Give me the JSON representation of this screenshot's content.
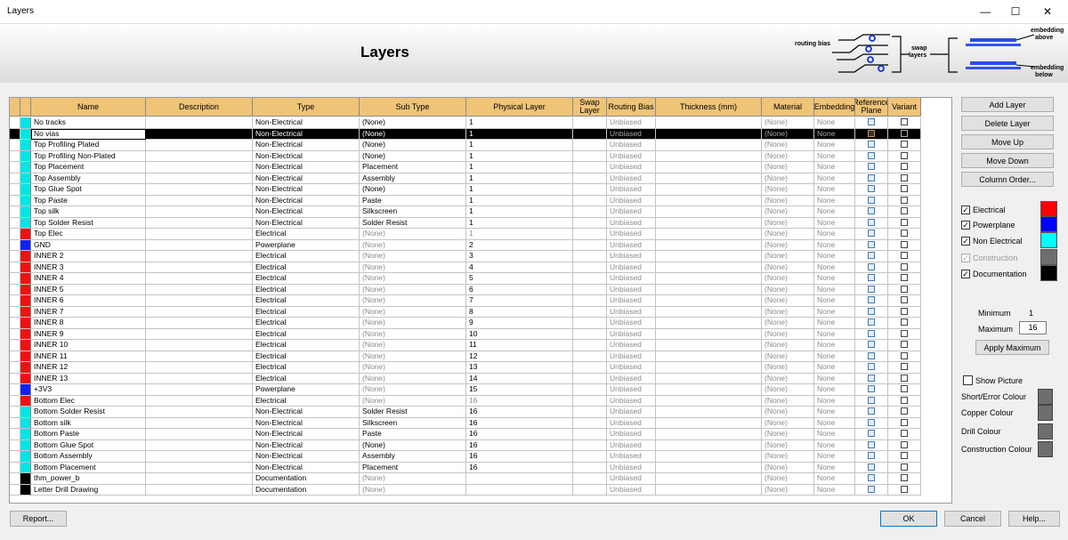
{
  "window": {
    "title": "Layers",
    "controls": [
      "—",
      "☐",
      "✕"
    ]
  },
  "header": {
    "title": "Layers",
    "diagram": {
      "routing_bias": "routing bias",
      "swap1": "swap",
      "swap2": "layers",
      "emb_above1": "embedding",
      "emb_above2": "above",
      "emb_below1": "embedding",
      "emb_below2": "below"
    }
  },
  "columns": [
    "Name",
    "Description",
    "Type",
    "Sub Type",
    "Physical Layer",
    "Swap Layer",
    "Routing Bias",
    "Thickness (mm)",
    "Material",
    "Embedding",
    "Reference Plane",
    "Variant"
  ],
  "rows": [
    {
      "color": "#00e5e5",
      "name": "No tracks",
      "desc": "",
      "type": "Non-Electrical",
      "subtype": "(None)",
      "sub_gray": false,
      "phys": "1",
      "phys_gray": false,
      "bias": "Unbiased",
      "mat": "(None)",
      "emb": "None",
      "sel": false
    },
    {
      "color": "#00e5e5",
      "name": "No vias",
      "desc": "",
      "type": "Non-Electrical",
      "subtype": "(None)",
      "sub_gray": false,
      "phys": "1",
      "phys_gray": false,
      "bias": "Unbiased",
      "mat": "(None)",
      "emb": "None",
      "sel": true
    },
    {
      "color": "#00e5e5",
      "name": "Top Profiling Plated",
      "desc": "",
      "type": "Non-Electrical",
      "subtype": "(None)",
      "sub_gray": false,
      "phys": "1",
      "phys_gray": false,
      "bias": "Unbiased",
      "mat": "(None)",
      "emb": "None",
      "sel": false
    },
    {
      "color": "#00e5e5",
      "name": "Top Profiling Non-Plated",
      "desc": "",
      "type": "Non-Electrical",
      "subtype": "(None)",
      "sub_gray": false,
      "phys": "1",
      "phys_gray": false,
      "bias": "Unbiased",
      "mat": "(None)",
      "emb": "None",
      "sel": false
    },
    {
      "color": "#00e5e5",
      "name": "Top Placement",
      "desc": "",
      "type": "Non-Electrical",
      "subtype": "Placement",
      "sub_gray": false,
      "phys": "1",
      "phys_gray": false,
      "bias": "Unbiased",
      "mat": "(None)",
      "emb": "None",
      "sel": false
    },
    {
      "color": "#00e5e5",
      "name": "Top Assembly",
      "desc": "",
      "type": "Non-Electrical",
      "subtype": "Assembly",
      "sub_gray": false,
      "phys": "1",
      "phys_gray": false,
      "bias": "Unbiased",
      "mat": "(None)",
      "emb": "None",
      "sel": false
    },
    {
      "color": "#00e5e5",
      "name": "Top Glue Spot",
      "desc": "",
      "type": "Non-Electrical",
      "subtype": "(None)",
      "sub_gray": false,
      "phys": "1",
      "phys_gray": false,
      "bias": "Unbiased",
      "mat": "(None)",
      "emb": "None",
      "sel": false
    },
    {
      "color": "#00e5e5",
      "name": "Top Paste",
      "desc": "",
      "type": "Non-Electrical",
      "subtype": "Paste",
      "sub_gray": false,
      "phys": "1",
      "phys_gray": false,
      "bias": "Unbiased",
      "mat": "(None)",
      "emb": "None",
      "sel": false
    },
    {
      "color": "#00e5e5",
      "name": "Top silk",
      "desc": "",
      "type": "Non-Electrical",
      "subtype": "Silkscreen",
      "sub_gray": false,
      "phys": "1",
      "phys_gray": false,
      "bias": "Unbiased",
      "mat": "(None)",
      "emb": "None",
      "sel": false
    },
    {
      "color": "#00e5e5",
      "name": "Top Solder Resist",
      "desc": "",
      "type": "Non-Electrical",
      "subtype": "Solder Resist",
      "sub_gray": false,
      "phys": "1",
      "phys_gray": false,
      "bias": "Unbiased",
      "mat": "(None)",
      "emb": "None",
      "sel": false
    },
    {
      "color": "#ee1111",
      "name": "Top Elec",
      "desc": "",
      "type": "Electrical",
      "subtype": "(None)",
      "sub_gray": true,
      "phys": "1",
      "phys_gray": true,
      "bias": "Unbiased",
      "mat": "(None)",
      "emb": "None",
      "sel": false
    },
    {
      "color": "#1122ee",
      "name": "GND",
      "desc": "",
      "type": "Powerplane",
      "subtype": "(None)",
      "sub_gray": true,
      "phys": "2",
      "phys_gray": false,
      "bias": "Unbiased",
      "mat": "(None)",
      "emb": "None",
      "sel": false
    },
    {
      "color": "#ee1111",
      "name": "INNER 2",
      "desc": "",
      "type": "Electrical",
      "subtype": "(None)",
      "sub_gray": true,
      "phys": "3",
      "phys_gray": false,
      "bias": "Unbiased",
      "mat": "(None)",
      "emb": "None",
      "sel": false
    },
    {
      "color": "#ee1111",
      "name": "INNER 3",
      "desc": "",
      "type": "Electrical",
      "subtype": "(None)",
      "sub_gray": true,
      "phys": "4",
      "phys_gray": false,
      "bias": "Unbiased",
      "mat": "(None)",
      "emb": "None",
      "sel": false
    },
    {
      "color": "#ee1111",
      "name": "INNER 4",
      "desc": "",
      "type": "Electrical",
      "subtype": "(None)",
      "sub_gray": true,
      "phys": "5",
      "phys_gray": false,
      "bias": "Unbiased",
      "mat": "(None)",
      "emb": "None",
      "sel": false
    },
    {
      "color": "#ee1111",
      "name": "INNER 5",
      "desc": "",
      "type": "Electrical",
      "subtype": "(None)",
      "sub_gray": true,
      "phys": "6",
      "phys_gray": false,
      "bias": "Unbiased",
      "mat": "(None)",
      "emb": "None",
      "sel": false
    },
    {
      "color": "#ee1111",
      "name": "INNER 6",
      "desc": "",
      "type": "Electrical",
      "subtype": "(None)",
      "sub_gray": true,
      "phys": "7",
      "phys_gray": false,
      "bias": "Unbiased",
      "mat": "(None)",
      "emb": "None",
      "sel": false
    },
    {
      "color": "#ee1111",
      "name": "INNER 7",
      "desc": "",
      "type": "Electrical",
      "subtype": "(None)",
      "sub_gray": true,
      "phys": "8",
      "phys_gray": false,
      "bias": "Unbiased",
      "mat": "(None)",
      "emb": "None",
      "sel": false
    },
    {
      "color": "#ee1111",
      "name": "INNER 8",
      "desc": "",
      "type": "Electrical",
      "subtype": "(None)",
      "sub_gray": true,
      "phys": "9",
      "phys_gray": false,
      "bias": "Unbiased",
      "mat": "(None)",
      "emb": "None",
      "sel": false
    },
    {
      "color": "#ee1111",
      "name": "INNER 9",
      "desc": "",
      "type": "Electrical",
      "subtype": "(None)",
      "sub_gray": true,
      "phys": "10",
      "phys_gray": false,
      "bias": "Unbiased",
      "mat": "(None)",
      "emb": "None",
      "sel": false
    },
    {
      "color": "#ee1111",
      "name": "INNER 10",
      "desc": "",
      "type": "Electrical",
      "subtype": "(None)",
      "sub_gray": true,
      "phys": "11",
      "phys_gray": false,
      "bias": "Unbiased",
      "mat": "(None)",
      "emb": "None",
      "sel": false
    },
    {
      "color": "#ee1111",
      "name": "INNER 11",
      "desc": "",
      "type": "Electrical",
      "subtype": "(None)",
      "sub_gray": true,
      "phys": "12",
      "phys_gray": false,
      "bias": "Unbiased",
      "mat": "(None)",
      "emb": "None",
      "sel": false
    },
    {
      "color": "#ee1111",
      "name": "INNER 12",
      "desc": "",
      "type": "Electrical",
      "subtype": "(None)",
      "sub_gray": true,
      "phys": "13",
      "phys_gray": false,
      "bias": "Unbiased",
      "mat": "(None)",
      "emb": "None",
      "sel": false
    },
    {
      "color": "#ee1111",
      "name": "INNER 13",
      "desc": "",
      "type": "Electrical",
      "subtype": "(None)",
      "sub_gray": true,
      "phys": "14",
      "phys_gray": false,
      "bias": "Unbiased",
      "mat": "(None)",
      "emb": "None",
      "sel": false
    },
    {
      "color": "#1122ee",
      "name": "+3V3",
      "desc": "",
      "type": "Powerplane",
      "subtype": "(None)",
      "sub_gray": true,
      "phys": "15",
      "phys_gray": false,
      "bias": "Unbiased",
      "mat": "(None)",
      "emb": "None",
      "sel": false
    },
    {
      "color": "#ee1111",
      "name": "Bottom Elec",
      "desc": "",
      "type": "Electrical",
      "subtype": "(None)",
      "sub_gray": true,
      "phys": "16",
      "phys_gray": true,
      "bias": "Unbiased",
      "mat": "(None)",
      "emb": "None",
      "sel": false
    },
    {
      "color": "#00e5e5",
      "name": "Bottom Solder Resist",
      "desc": "",
      "type": "Non-Electrical",
      "subtype": "Solder Resist",
      "sub_gray": false,
      "phys": "16",
      "phys_gray": false,
      "bias": "Unbiased",
      "mat": "(None)",
      "emb": "None",
      "sel": false
    },
    {
      "color": "#00e5e5",
      "name": "Bottom silk",
      "desc": "",
      "type": "Non-Electrical",
      "subtype": "Silkscreen",
      "sub_gray": false,
      "phys": "16",
      "phys_gray": false,
      "bias": "Unbiased",
      "mat": "(None)",
      "emb": "None",
      "sel": false
    },
    {
      "color": "#00e5e5",
      "name": "Bottom Paste",
      "desc": "",
      "type": "Non-Electrical",
      "subtype": "Paste",
      "sub_gray": false,
      "phys": "16",
      "phys_gray": false,
      "bias": "Unbiased",
      "mat": "(None)",
      "emb": "None",
      "sel": false
    },
    {
      "color": "#00e5e5",
      "name": "Bottom Glue Spot",
      "desc": "",
      "type": "Non-Electrical",
      "subtype": "(None)",
      "sub_gray": false,
      "phys": "16",
      "phys_gray": false,
      "bias": "Unbiased",
      "mat": "(None)",
      "emb": "None",
      "sel": false
    },
    {
      "color": "#00e5e5",
      "name": "Bottom Assembly",
      "desc": "",
      "type": "Non-Electrical",
      "subtype": "Assembly",
      "sub_gray": false,
      "phys": "16",
      "phys_gray": false,
      "bias": "Unbiased",
      "mat": "(None)",
      "emb": "None",
      "sel": false
    },
    {
      "color": "#00e5e5",
      "name": "Bottom Placement",
      "desc": "",
      "type": "Non-Electrical",
      "subtype": "Placement",
      "sub_gray": false,
      "phys": "16",
      "phys_gray": false,
      "bias": "Unbiased",
      "mat": "(None)",
      "emb": "None",
      "sel": false
    },
    {
      "color": "#000000",
      "name": "thm_power_b",
      "desc": "",
      "type": "Documentation",
      "subtype": "(None)",
      "sub_gray": true,
      "phys": "",
      "phys_gray": false,
      "bias": "Unbiased",
      "mat": "(None)",
      "emb": "None",
      "sel": false
    },
    {
      "color": "#000000",
      "name": "Letter Drill Drawing",
      "desc": "",
      "type": "Documentation",
      "subtype": "(None)",
      "sub_gray": true,
      "phys": "",
      "phys_gray": false,
      "bias": "Unbiased",
      "mat": "(None)",
      "emb": "None",
      "sel": false
    }
  ],
  "side_buttons": {
    "add": "Add Layer",
    "delete": "Delete Layer",
    "up": "Move Up",
    "down": "Move Down",
    "order": "Column Order..."
  },
  "legend": [
    {
      "label": "Electrical",
      "checked": true,
      "color": "#ff0000",
      "dim": false
    },
    {
      "label": "Powerplane",
      "checked": true,
      "color": "#0000ff",
      "dim": false
    },
    {
      "label": "Non Electrical",
      "checked": true,
      "color": "#00ffff",
      "dim": false
    },
    {
      "label": "Construction",
      "checked": true,
      "color": "#6e6e6e",
      "dim": true
    },
    {
      "label": "Documentation",
      "checked": true,
      "color": "#000000",
      "dim": false
    }
  ],
  "minmax": {
    "min_label": "Minimum",
    "min_value": "1",
    "max_label": "Maximum",
    "max_value": "16",
    "apply": "Apply Maximum"
  },
  "picture": {
    "show": "Show Picture",
    "short": "Short/Error Colour",
    "copper": "Copper Colour",
    "drill": "Drill Colour",
    "construction": "Construction Colour"
  },
  "footer": {
    "report": "Report...",
    "ok": "OK",
    "cancel": "Cancel",
    "help": "Help..."
  }
}
